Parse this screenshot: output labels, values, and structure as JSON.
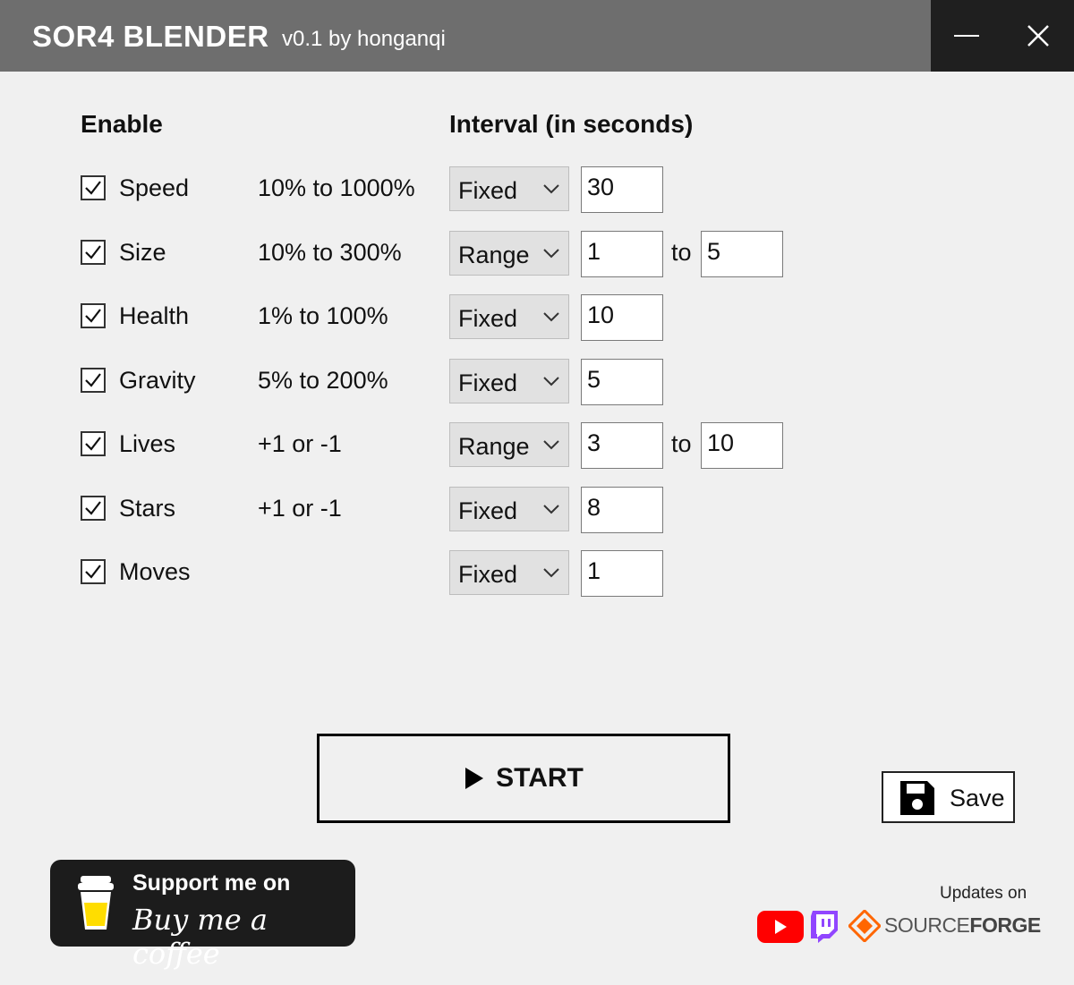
{
  "titlebar": {
    "app_name": "SOR4 BLENDER",
    "subtitle": "v0.1 by honganqi"
  },
  "headers": {
    "enable": "Enable",
    "interval": "Interval (in seconds)"
  },
  "rows": [
    {
      "label": "Speed",
      "checked": true,
      "range": "10% to 1000%",
      "mode": "Fixed",
      "value1": "30",
      "to": "",
      "value2": ""
    },
    {
      "label": "Size",
      "checked": true,
      "range": "10% to 300%",
      "mode": "Range",
      "value1": "1",
      "to": "to",
      "value2": "5"
    },
    {
      "label": "Health",
      "checked": true,
      "range": "1% to 100%",
      "mode": "Fixed",
      "value1": "10",
      "to": "",
      "value2": ""
    },
    {
      "label": "Gravity",
      "checked": true,
      "range": "5% to 200%",
      "mode": "Fixed",
      "value1": "5",
      "to": "",
      "value2": ""
    },
    {
      "label": "Lives",
      "checked": true,
      "range": "+1 or -1",
      "mode": "Range",
      "value1": "3",
      "to": "to",
      "value2": "10"
    },
    {
      "label": "Stars",
      "checked": true,
      "range": "+1 or -1",
      "mode": "Fixed",
      "value1": "8",
      "to": "",
      "value2": ""
    },
    {
      "label": "Moves",
      "checked": true,
      "range": "",
      "mode": "Fixed",
      "value1": "1",
      "to": "",
      "value2": ""
    }
  ],
  "actions": {
    "start_label": "START",
    "save_label": "Save"
  },
  "support": {
    "line1": "Support me on",
    "line2": "Buy me a coffee"
  },
  "footer": {
    "updates_label": "Updates on",
    "sourceforge_a": "SOURCE",
    "sourceforge_b": "FORGE"
  },
  "colors": {
    "titlebar": "#6e6e6e",
    "youtube": "#ff0000",
    "twitch": "#9146ff",
    "sourceforge": "#ff6600"
  }
}
